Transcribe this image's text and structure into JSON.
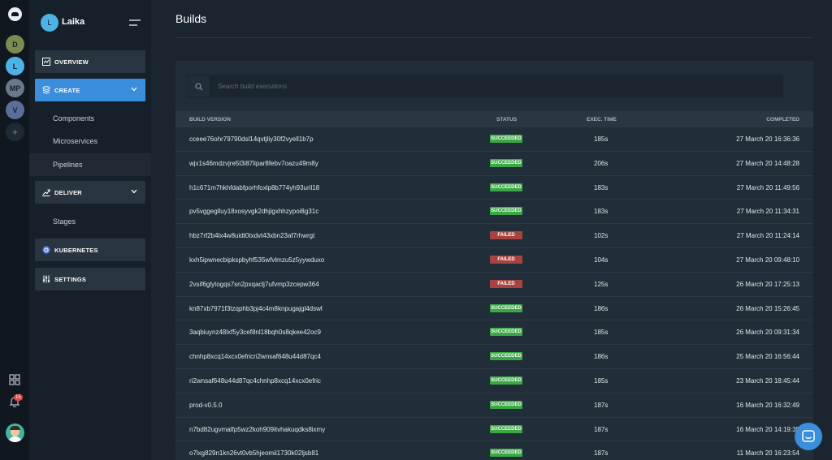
{
  "workspaces": [
    {
      "initial": "D",
      "color": "#7a8c52"
    },
    {
      "initial": "L",
      "color": "#4db3e6"
    },
    {
      "initial": "MP",
      "color": "#6a7a8c"
    },
    {
      "initial": "V",
      "color": "#5a6e9c"
    }
  ],
  "workspace_add": "+",
  "notifications_count": "15",
  "project": {
    "initial": "L",
    "name": "Laika"
  },
  "nav": {
    "overview": "OVERVIEW",
    "create": "CREATE",
    "components": "Components",
    "microservices": "Microservices",
    "pipelines": "Pipelines",
    "deliver": "DELIVER",
    "stages": "Stages",
    "kubernetes": "KUBERNETES",
    "settings": "SETTINGS"
  },
  "page": {
    "title": "Builds"
  },
  "search": {
    "placeholder": "Search build executions"
  },
  "table": {
    "headers": {
      "version": "BUILD VERSION",
      "status": "STATUS",
      "exec_time": "EXEC. TIME",
      "completed": "COMPLETED"
    },
    "rows": [
      {
        "version": "cceee76ohr79790dsl14qvtjliy30f2vyell1b7p",
        "status": "SUCCEEDED",
        "exec_time": "185s",
        "completed": "27 March 20 16:36:36"
      },
      {
        "version": "wjx1s46mdzvjre5l3i87lipar8febv7oazu49m8y",
        "status": "SUCCEEDED",
        "exec_time": "206s",
        "completed": "27 March 20 14:48:28"
      },
      {
        "version": "h1c671m7hkhfdabfporhfoxlp8b774yh93uril18",
        "status": "SUCCEEDED",
        "exec_time": "183s",
        "completed": "27 March 20 11:49:56"
      },
      {
        "version": "pv5vggeglluy18xosyvgk2dhjigxhhzypoi8g31c",
        "status": "SUCCEEDED",
        "exec_time": "183s",
        "completed": "27 March 20 11:34:31"
      },
      {
        "version": "hbz7rf2b4lx4w8uidt0txdvt43xbn23af7rhwrgt",
        "status": "FAILED",
        "exec_time": "102s",
        "completed": "27 March 20 11:24:14"
      },
      {
        "version": "kxh5ipwnecbipkspbyhf535wfvlmzu5z5yywduxo",
        "status": "FAILED",
        "exec_time": "104s",
        "completed": "27 March 20 09:48:10"
      },
      {
        "version": "2vsif6glytogqs7sn2pxqaclj7ufvmp3zcepw364",
        "status": "FAILED",
        "exec_time": "125s",
        "completed": "26 March 20 17:25:13"
      },
      {
        "version": "kn87xb7971f3tzqphb3pj4c4m8knpugajgl4dswl",
        "status": "SUCCEEDED",
        "exec_time": "186s",
        "completed": "26 March 20 15:26:45"
      },
      {
        "version": "3aqbiuynz48lxf5y3cef8nl18bqh0s8qkee42oc9",
        "status": "SUCCEEDED",
        "exec_time": "185s",
        "completed": "26 March 20 09:31:34"
      },
      {
        "version": "chnhp8xcq14xcx0efricri2wnsaf648u44d87qc4",
        "status": "SUCCEEDED",
        "exec_time": "186s",
        "completed": "25 March 20 16:56:44"
      },
      {
        "version": "ri2wnsaf648u44d87qc4chnhp8xcq14xcx0efric",
        "status": "SUCCEEDED",
        "exec_time": "185s",
        "completed": "23 March 20 18:45:44"
      },
      {
        "version": "prod-v0.5.0",
        "status": "SUCCEEDED",
        "exec_time": "187s",
        "completed": "16 March 20 16:32:49"
      },
      {
        "version": "n7bd82ugvmalfp5wz2koh909itvhakuqdks8ixmy",
        "status": "SUCCEEDED",
        "exec_time": "187s",
        "completed": "16 March 20 14:19:39"
      },
      {
        "version": "o7lxg829n1kn26vt0vb5hjeomii1730k02ljsb81",
        "status": "SUCCEEDED",
        "exec_time": "187s",
        "completed": "11 March 20 16:23:54"
      }
    ]
  },
  "colors": {
    "accent": "#3a8edb",
    "succeeded": "#3aa845",
    "failed": "#a8433f"
  }
}
